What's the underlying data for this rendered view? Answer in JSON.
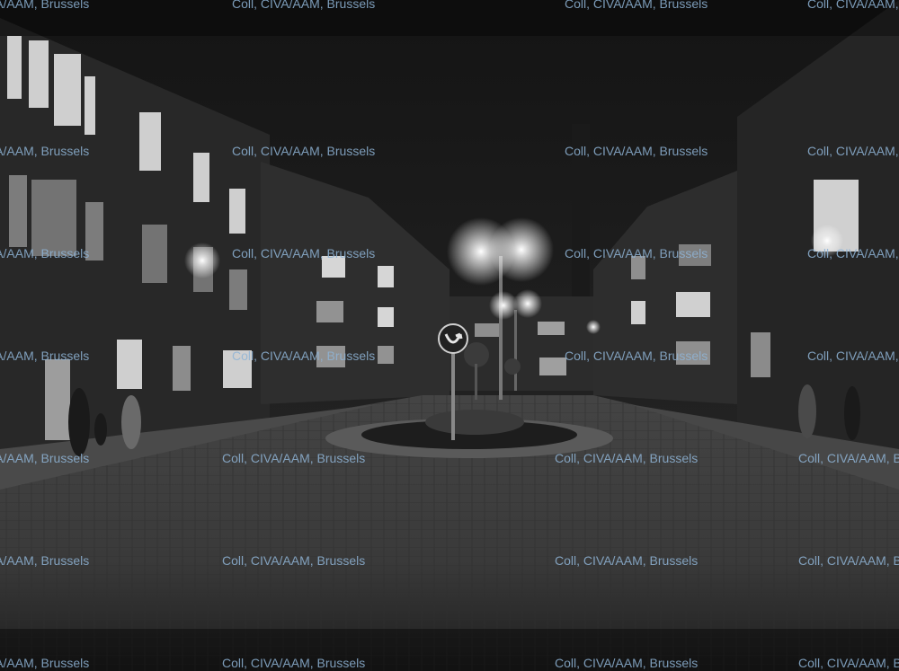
{
  "watermark": {
    "text": "Coll, CIVA/AAM, Brussels",
    "color": "#8fb4d6"
  },
  "photo": {
    "palette": {
      "sky": "#1c1c1c",
      "building": "#2b2b2b",
      "window_lit": "#d9d9d9",
      "road": "#3a3a3a",
      "lamp_glow": "#ffffff"
    }
  }
}
